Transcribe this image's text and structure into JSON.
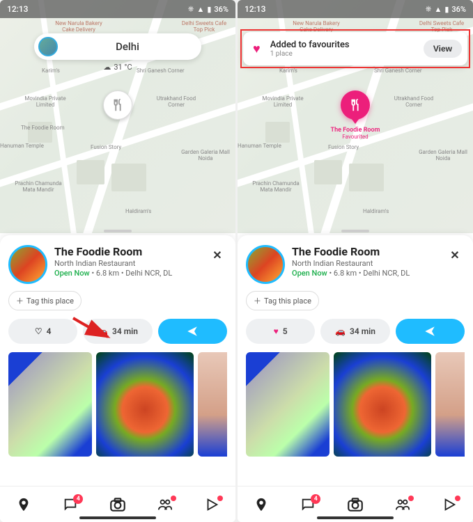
{
  "status": {
    "time": "12:13",
    "battery": "36%"
  },
  "map": {
    "search": "Delhi",
    "temp": "31 °C",
    "labels": {
      "top1": "New Narula Bakery\nCake Delivery",
      "top2": "Delhi Sweets Cafe\nTop Pick",
      "l1": "Karim's",
      "l2": "Shri Ganesh Corner",
      "l3": "Movindia\nPrivate Limited",
      "l4": "Utrakhand\nFood Corner",
      "l5": "The Foodie Room",
      "l6": "Hanuman Temple",
      "l7": "Fusion Story",
      "l8": "Garden Galeria\nMall Noida",
      "l9": "Prachin Chamunda\nMata Mandir",
      "l10": "Haldiram's"
    },
    "pin_label": {
      "name": "The Foodie Room",
      "status": "Favourited"
    }
  },
  "toast": {
    "title": "Added to favourites",
    "sub": "1 place",
    "btn": "View"
  },
  "place": {
    "name": "The Foodie Room",
    "category": "North Indian Restaurant",
    "open": "Open Now",
    "dist": "6.8 km",
    "region": "Delhi NCR, DL",
    "tag": "Tag this place",
    "likes_before": "4",
    "likes_after": "5",
    "drive": "34 min"
  },
  "nav": {
    "chat_badge": "4"
  }
}
